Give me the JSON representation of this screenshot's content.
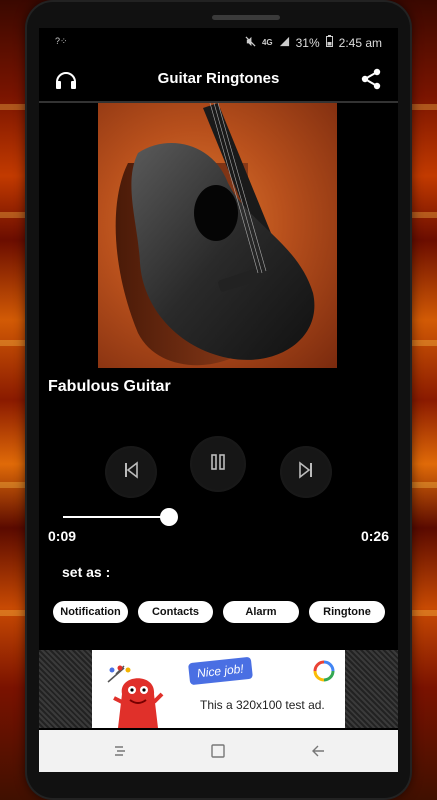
{
  "status_bar": {
    "signal_label": "?⁘",
    "network": "4G",
    "battery": "31%",
    "time": "2:45 am"
  },
  "app_bar": {
    "title": "Guitar Ringtones",
    "left_icon": "headphones-icon",
    "right_icon": "share-icon"
  },
  "player": {
    "track_title": "Fabulous Guitar",
    "current_time": "0:09",
    "total_time": "0:26",
    "progress_fraction": 0.35,
    "prev_icon": "previous-track-icon",
    "play_icon": "pause-icon",
    "next_icon": "next-track-icon"
  },
  "set_as": {
    "label": "set as :",
    "options": [
      "Notification",
      "Contacts",
      "Alarm",
      "Ringtone"
    ]
  },
  "ad": {
    "bubble_text": "Nice job!",
    "body_text": "This a 320x100 test ad."
  },
  "nav_bar": {
    "icons": [
      "recents-icon",
      "home-icon",
      "back-icon"
    ]
  },
  "colors": {
    "background_accent": "#c23a00",
    "screen_bg": "#000000",
    "chip_bg": "#ffffff",
    "ad_bubble": "#4a6fe3",
    "ad_monster": "#e0302a"
  }
}
